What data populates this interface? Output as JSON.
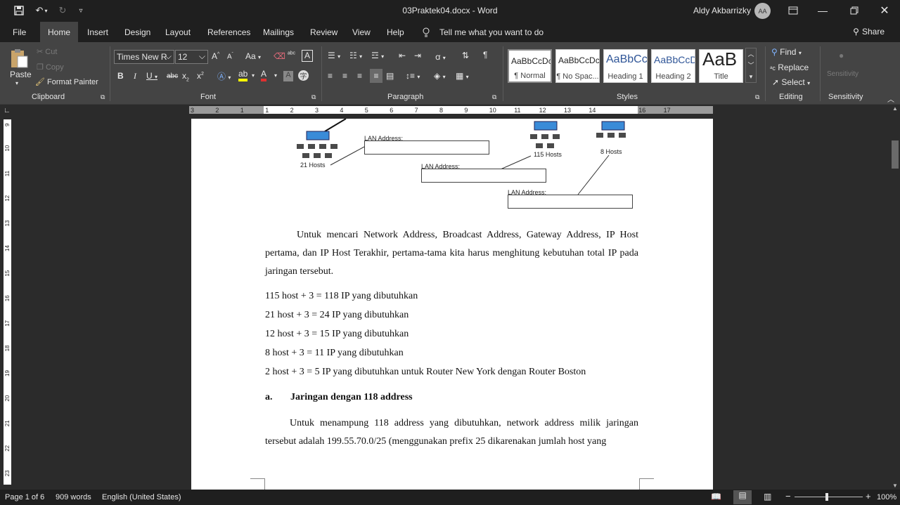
{
  "title_bar": {
    "document_title": "03Praktek04.docx  -  Word",
    "user_name": "Aldy Akbarrizky",
    "avatar_initials": "AA",
    "quick_access": [
      "save-icon",
      "undo-icon",
      "redo-icon",
      "customize-icon"
    ]
  },
  "menu": {
    "tabs": [
      "File",
      "Home",
      "Insert",
      "Design",
      "Layout",
      "References",
      "Mailings",
      "Review",
      "View",
      "Help"
    ],
    "active_tab": "Home",
    "tell_me": "Tell me what you want to do",
    "share": "Share"
  },
  "ribbon": {
    "clipboard": {
      "paste": "Paste",
      "cut": "Cut",
      "copy": "Copy",
      "format_painter": "Format Painter",
      "label": "Clipboard"
    },
    "font": {
      "font_name": "Times New R",
      "font_size": "12",
      "label": "Font"
    },
    "paragraph": {
      "label": "Paragraph"
    },
    "styles": {
      "label": "Styles",
      "items": [
        {
          "preview": "AaBbCcDc",
          "name": "¶ Normal"
        },
        {
          "preview": "AaBbCcDc",
          "name": "¶ No Spac..."
        },
        {
          "preview": "AaBbCc",
          "name": "Heading 1"
        },
        {
          "preview": "AaBbCcD",
          "name": "Heading 2"
        },
        {
          "preview": "AaB",
          "name": "Title"
        }
      ]
    },
    "editing": {
      "find": "Find",
      "replace": "Replace",
      "select": "Select",
      "label": "Editing"
    },
    "sensitivity": {
      "button": "Sensitivity",
      "label": "Sensitivity"
    }
  },
  "ruler": {
    "h_marks": [
      "3",
      "2",
      "1",
      "1",
      "2",
      "3",
      "4",
      "5",
      "6",
      "7",
      "8",
      "9",
      "10",
      "11",
      "12",
      "13",
      "14",
      "16",
      "17"
    ],
    "v_marks": [
      "9",
      "10",
      "11",
      "12",
      "13",
      "14",
      "15",
      "16",
      "17",
      "18",
      "19",
      "20",
      "21",
      "22",
      "23"
    ]
  },
  "document": {
    "diagram": {
      "lan_label_1": "LAN Address:",
      "lan_label_2": "LAN Address:",
      "lan_label_3": "LAN Address:",
      "hosts_21": "21 Hosts",
      "hosts_115": "115 Hosts",
      "hosts_8": "8 Hosts"
    },
    "intro": "Untuk mencari Network Address, Broadcast Address, Gateway Address, IP Host pertama, dan IP Host Terakhir, pertama-tama kita harus menghitung kebutuhan total IP pada jaringan tersebut.",
    "calc_lines": [
      "115 host + 3 = 118 IP yang dibutuhkan",
      "21 host + 3 = 24 IP yang dibutuhkan",
      "12 host + 3 = 15 IP yang dibutuhkan",
      "8 host + 3 = 11 IP yang dibutuhkan",
      "2 host + 3 = 5 IP yang dibutuhkan untuk Router New York dengan Router Boston"
    ],
    "heading_marker": "a.",
    "heading": "Jaringan dengan 118 address",
    "para2": "Untuk menampung 118 address yang dibutuhkan, network address milik jaringan tersebut adalah 199.55.70.0/25 (menggunakan prefix 25 dikarenakan jumlah host yang"
  },
  "status": {
    "page": "Page 1 of 6",
    "words": "909 words",
    "language": "English (United States)",
    "zoom": "100%"
  }
}
